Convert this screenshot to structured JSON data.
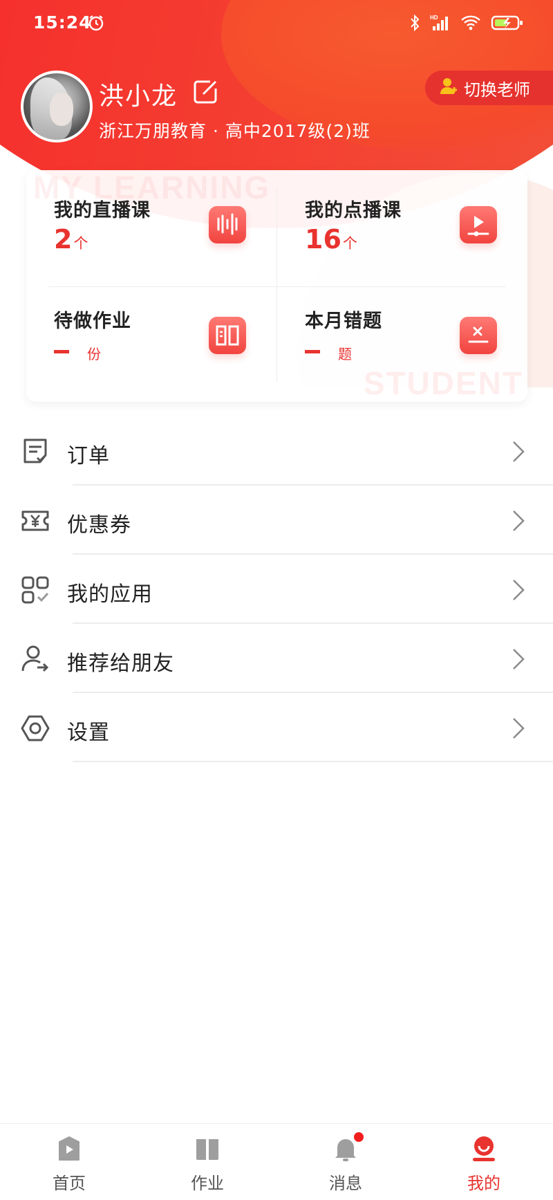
{
  "status_bar": {
    "time": "15:24"
  },
  "profile": {
    "name": "洪小龙",
    "school": "浙江万朋教育 · 高中2017级(2)班",
    "switch_label": "切换老师"
  },
  "learning": {
    "watermark_top": "MY LEARNING",
    "watermark_bottom": "STUDENT",
    "items": [
      {
        "title": "我的直播课",
        "value": "2",
        "unit": "个",
        "icon": "live-course-icon"
      },
      {
        "title": "我的点播课",
        "value": "16",
        "unit": "个",
        "icon": "vod-course-icon"
      },
      {
        "title": "待做作业",
        "value": "",
        "unit": "份",
        "icon": "homework-book-icon"
      },
      {
        "title": "本月错题",
        "value": "",
        "unit": "题",
        "icon": "wrong-questions-icon"
      }
    ]
  },
  "menu": [
    {
      "label": "订单",
      "icon": "order-icon"
    },
    {
      "label": "优惠券",
      "icon": "coupon-icon"
    },
    {
      "label": "我的应用",
      "icon": "apps-icon"
    },
    {
      "label": "推荐给朋友",
      "icon": "share-friend-icon"
    },
    {
      "label": "设置",
      "icon": "settings-icon"
    }
  ],
  "tabs": [
    {
      "label": "首页",
      "icon": "home-play-icon"
    },
    {
      "label": "作业",
      "icon": "homework-icon"
    },
    {
      "label": "消息",
      "icon": "bell-icon",
      "has_badge": true
    },
    {
      "label": "我的",
      "icon": "profile-icon",
      "active": true
    }
  ],
  "colors": {
    "brand_red": "#e8332f",
    "header_red": "#f7262a",
    "text": "#222222"
  }
}
